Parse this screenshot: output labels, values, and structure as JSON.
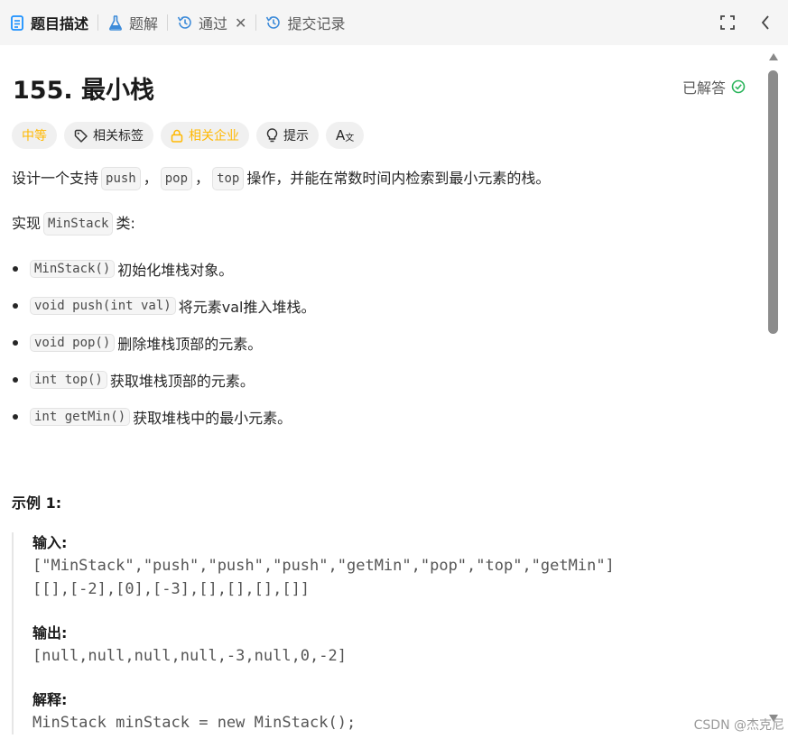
{
  "tabs": [
    {
      "label": "题目描述",
      "icon": "description-icon",
      "active": true
    },
    {
      "label": "题解",
      "icon": "flask-icon",
      "active": false
    },
    {
      "label": "通过",
      "icon": "history-icon",
      "active": false,
      "closable": true
    },
    {
      "label": "提交记录",
      "icon": "history-icon",
      "active": false
    }
  ],
  "problem": {
    "title": "155. 最小栈",
    "status": "已解答"
  },
  "tags": {
    "difficulty": "中等",
    "related_tags": "相关标签",
    "related_companies": "相关企业",
    "hint": "提示",
    "translate": "A"
  },
  "description": {
    "p1_before": "设计一个支持",
    "p1_code1": "push",
    "p1_sep1": "，",
    "p1_code2": "pop",
    "p1_sep2": "，",
    "p1_code3": "top",
    "p1_after": "操作，并能在常数时间内检索到最小元素的栈。",
    "p2_before": "实现",
    "p2_code": "MinStack",
    "p2_after": "类:"
  },
  "methods": [
    {
      "code": "MinStack()",
      "text": "初始化堆栈对象。"
    },
    {
      "code": "void push(int val)",
      "text": "将元素val推入堆栈。"
    },
    {
      "code": "void pop()",
      "text": "删除堆栈顶部的元素。"
    },
    {
      "code": "int top()",
      "text": "获取堆栈顶部的元素。"
    },
    {
      "code": "int getMin()",
      "text": "获取堆栈中的最小元素。"
    }
  ],
  "example": {
    "title": "示例 1:",
    "input_label": "输入:",
    "input_line1": "[\"MinStack\",\"push\",\"push\",\"push\",\"getMin\",\"pop\",\"top\",\"getMin\"]",
    "input_line2": "[[],[-2],[0],[-3],[],[],[],[]]",
    "output_label": "输出:",
    "output_line": "[null,null,null,null,-3,null,0,-2]",
    "explain_label": "解释:",
    "explain_line1": "MinStack minStack = new MinStack();"
  },
  "watermark": "CSDN @杰克尼",
  "colors": {
    "accent_blue": "#1a90ff",
    "difficulty_yellow": "#ffb800",
    "solved_green": "#2db55d"
  }
}
